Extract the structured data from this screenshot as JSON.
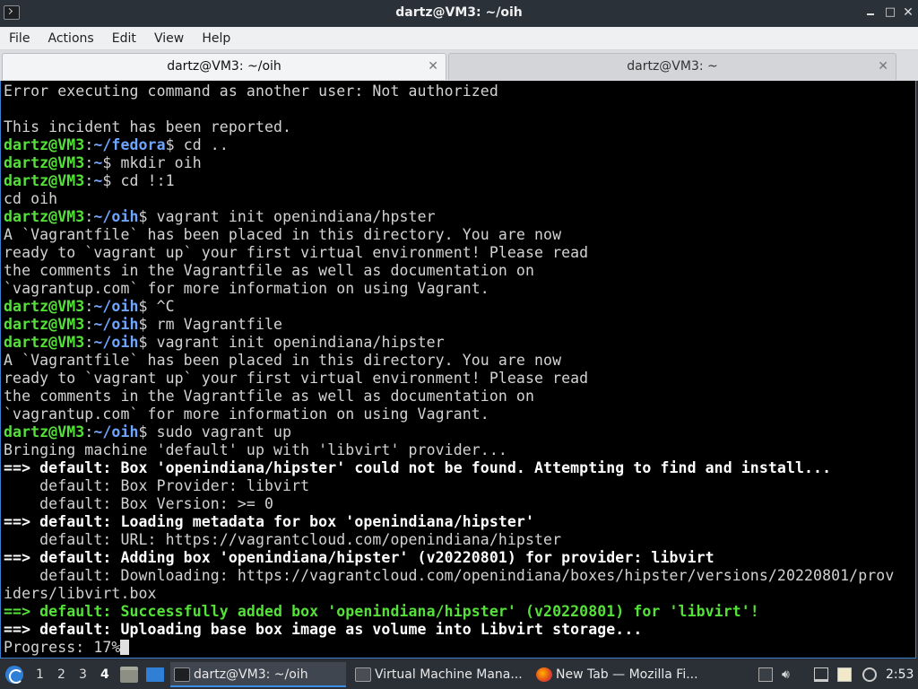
{
  "window": {
    "title": "dartz@VM3: ~/oih"
  },
  "menu": [
    "File",
    "Actions",
    "Edit",
    "View",
    "Help"
  ],
  "tabs": [
    {
      "label": "dartz@VM3: ~/oih",
      "active": true
    },
    {
      "label": "dartz@VM3: ~",
      "active": false
    }
  ],
  "terminal": {
    "lines": [
      [
        {
          "t": "Error executing command as another user: Not authorized"
        }
      ],
      [
        {
          "t": ""
        }
      ],
      [
        {
          "t": "This incident has been reported."
        }
      ],
      [
        {
          "t": "dartz@VM3",
          "c": "u"
        },
        {
          "t": ":"
        },
        {
          "t": "~/fedora",
          "c": "p"
        },
        {
          "t": "$ cd .."
        }
      ],
      [
        {
          "t": "dartz@VM3",
          "c": "u"
        },
        {
          "t": ":"
        },
        {
          "t": "~",
          "c": "p"
        },
        {
          "t": "$ mkdir oih"
        }
      ],
      [
        {
          "t": "dartz@VM3",
          "c": "u"
        },
        {
          "t": ":"
        },
        {
          "t": "~",
          "c": "p"
        },
        {
          "t": "$ cd !:1"
        }
      ],
      [
        {
          "t": "cd oih"
        }
      ],
      [
        {
          "t": "dartz@VM3",
          "c": "u"
        },
        {
          "t": ":"
        },
        {
          "t": "~/oih",
          "c": "p"
        },
        {
          "t": "$ vagrant init openindiana/hpster"
        }
      ],
      [
        {
          "t": "A `Vagrantfile` has been placed in this directory. You are now"
        }
      ],
      [
        {
          "t": "ready to `vagrant up` your first virtual environment! Please read"
        }
      ],
      [
        {
          "t": "the comments in the Vagrantfile as well as documentation on"
        }
      ],
      [
        {
          "t": "`vagrantup.com` for more information on using Vagrant."
        }
      ],
      [
        {
          "t": "dartz@VM3",
          "c": "u"
        },
        {
          "t": ":"
        },
        {
          "t": "~/oih",
          "c": "p"
        },
        {
          "t": "$ ^C"
        }
      ],
      [
        {
          "t": "dartz@VM3",
          "c": "u"
        },
        {
          "t": ":"
        },
        {
          "t": "~/oih",
          "c": "p"
        },
        {
          "t": "$ rm Vagrantfile"
        }
      ],
      [
        {
          "t": "dartz@VM3",
          "c": "u"
        },
        {
          "t": ":"
        },
        {
          "t": "~/oih",
          "c": "p"
        },
        {
          "t": "$ vagrant init openindiana/hipster"
        }
      ],
      [
        {
          "t": "A `Vagrantfile` has been placed in this directory. You are now"
        }
      ],
      [
        {
          "t": "ready to `vagrant up` your first virtual environment! Please read"
        }
      ],
      [
        {
          "t": "the comments in the Vagrantfile as well as documentation on"
        }
      ],
      [
        {
          "t": "`vagrantup.com` for more information on using Vagrant."
        }
      ],
      [
        {
          "t": "dartz@VM3",
          "c": "u"
        },
        {
          "t": ":"
        },
        {
          "t": "~/oih",
          "c": "p"
        },
        {
          "t": "$ sudo vagrant up"
        }
      ],
      [
        {
          "t": "Bringing machine 'default' up with 'libvirt' provider..."
        }
      ],
      [
        {
          "t": "==> default: Box 'openindiana/hipster' could not be found. Attempting to find and install...",
          "c": "b"
        }
      ],
      [
        {
          "t": "    default: Box Provider: libvirt"
        }
      ],
      [
        {
          "t": "    default: Box Version: >= 0"
        }
      ],
      [
        {
          "t": "==> default: Loading metadata for box 'openindiana/hipster'",
          "c": "b"
        }
      ],
      [
        {
          "t": "    default: URL: https://vagrantcloud.com/openindiana/hipster"
        }
      ],
      [
        {
          "t": "==> default: Adding box 'openindiana/hipster' (v20220801) for provider: libvirt",
          "c": "b"
        }
      ],
      [
        {
          "t": "    default: Downloading: https://vagrantcloud.com/openindiana/boxes/hipster/versions/20220801/prov"
        }
      ],
      [
        {
          "t": "iders/libvirt.box"
        }
      ],
      [
        {
          "t": "==> default: Successfully added box 'openindiana/hipster' (v20220801) for 'libvirt'!",
          "c": "g"
        }
      ],
      [
        {
          "t": "==> default: Uploading base box image as volume into Libvirt storage...",
          "c": "b"
        }
      ],
      [
        {
          "t": "Progress: 17%"
        }
      ]
    ]
  },
  "taskbar": {
    "workspaces": [
      "1",
      "2",
      "3",
      "4"
    ],
    "active_workspace": "4",
    "tasks": [
      {
        "label": "dartz@VM3: ~/oih",
        "icon": "terminal-icon"
      },
      {
        "label": "Virtual Machine Mana...",
        "icon": "virt-manager-icon"
      },
      {
        "label": "New Tab — Mozilla Fi...",
        "icon": "firefox-icon"
      }
    ],
    "clock": "2:53"
  }
}
